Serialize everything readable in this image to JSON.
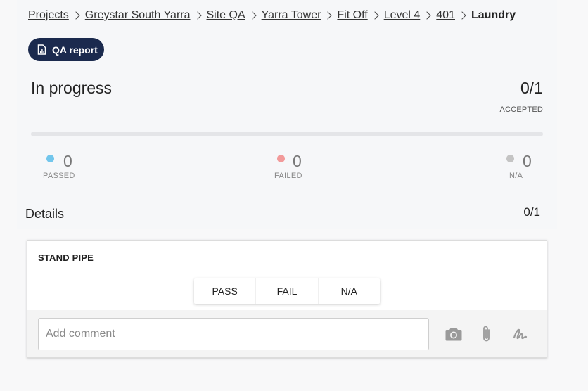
{
  "breadcrumb": {
    "items": [
      "Projects",
      "Greystar South Yarra",
      "Site QA",
      "Yarra Tower",
      "Fit Off",
      "Level 4",
      "401"
    ],
    "current": "Laundry"
  },
  "qa_report_label": "QA report",
  "summary": {
    "status": "In progress",
    "accepted_count": "0/1",
    "accepted_label": "ACCEPTED",
    "progress_fraction": 0,
    "stats": {
      "passed": {
        "value": "0",
        "label": "PASSED",
        "color": "#72c6ec"
      },
      "failed": {
        "value": "0",
        "label": "FAILED",
        "color": "#f29a9a"
      },
      "na": {
        "value": "0",
        "label": "N/A",
        "color": "#c4c4c4"
      }
    }
  },
  "details": {
    "title": "Details",
    "count": "0/1"
  },
  "item": {
    "title": "STAND PIPE",
    "options": [
      "PASS",
      "FAIL",
      "N/A"
    ],
    "comment_placeholder": "Add comment",
    "actions": [
      "camera-icon",
      "paperclip-icon",
      "signature-icon"
    ]
  },
  "colors": {
    "brand": "#1b2a4e",
    "icon_gray": "#9a9a9a"
  }
}
